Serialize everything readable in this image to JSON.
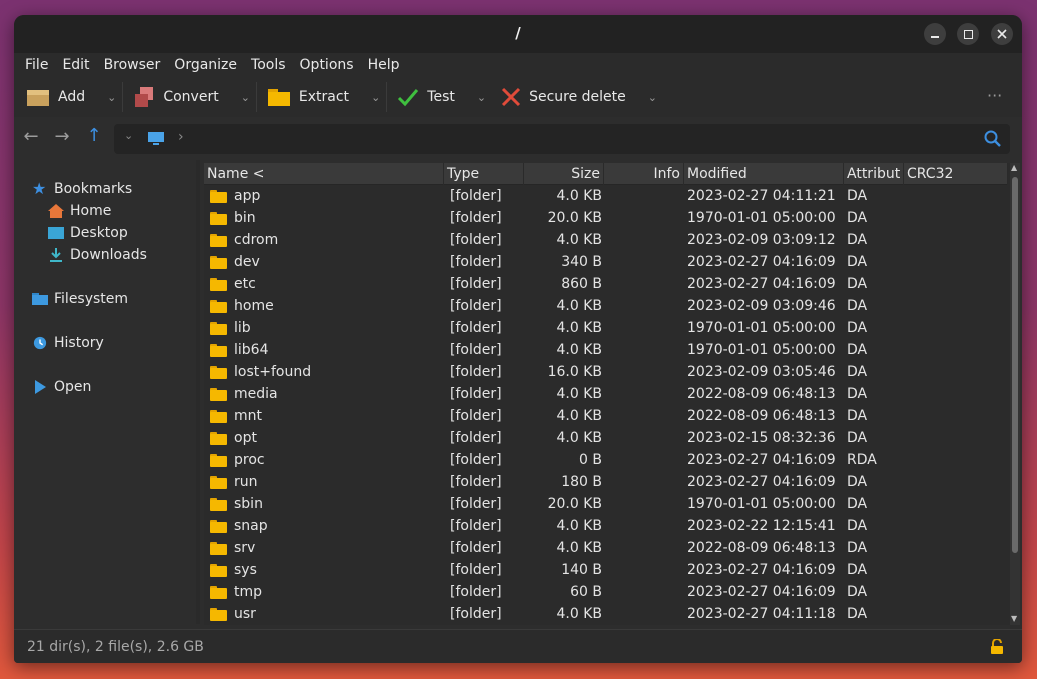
{
  "window": {
    "title": "/"
  },
  "menu": [
    "File",
    "Edit",
    "Browser",
    "Organize",
    "Tools",
    "Options",
    "Help"
  ],
  "toolbar": {
    "add_label": "Add",
    "convert_label": "Convert",
    "extract_label": "Extract",
    "test_label": "Test",
    "secure_delete_label": "Secure delete",
    "more": "···"
  },
  "sidebar": {
    "bookmarks": "Bookmarks",
    "home": "Home",
    "desktop": "Desktop",
    "downloads": "Downloads",
    "filesystem": "Filesystem",
    "history": "History",
    "open": "Open"
  },
  "columns": [
    "Name <",
    "Type",
    "Size",
    "Info",
    "Modified",
    "Attribut",
    "CRC32"
  ],
  "rows": [
    {
      "name": "app",
      "type": "[folder]",
      "size": "4.0 KB",
      "modified": "2023-02-27 04:11:21",
      "attr": "DA"
    },
    {
      "name": "bin",
      "type": "[folder]",
      "size": "20.0 KB",
      "modified": "1970-01-01 05:00:00",
      "attr": "DA"
    },
    {
      "name": "cdrom",
      "type": "[folder]",
      "size": "4.0 KB",
      "modified": "2023-02-09 03:09:12",
      "attr": "DA"
    },
    {
      "name": "dev",
      "type": "[folder]",
      "size": "340 B",
      "modified": "2023-02-27 04:16:09",
      "attr": "DA"
    },
    {
      "name": "etc",
      "type": "[folder]",
      "size": "860 B",
      "modified": "2023-02-27 04:16:09",
      "attr": "DA"
    },
    {
      "name": "home",
      "type": "[folder]",
      "size": "4.0 KB",
      "modified": "2023-02-09 03:09:46",
      "attr": "DA"
    },
    {
      "name": "lib",
      "type": "[folder]",
      "size": "4.0 KB",
      "modified": "1970-01-01 05:00:00",
      "attr": "DA"
    },
    {
      "name": "lib64",
      "type": "[folder]",
      "size": "4.0 KB",
      "modified": "1970-01-01 05:00:00",
      "attr": "DA"
    },
    {
      "name": "lost+found",
      "type": "[folder]",
      "size": "16.0 KB",
      "modified": "2023-02-09 03:05:46",
      "attr": "DA"
    },
    {
      "name": "media",
      "type": "[folder]",
      "size": "4.0 KB",
      "modified": "2022-08-09 06:48:13",
      "attr": "DA"
    },
    {
      "name": "mnt",
      "type": "[folder]",
      "size": "4.0 KB",
      "modified": "2022-08-09 06:48:13",
      "attr": "DA"
    },
    {
      "name": "opt",
      "type": "[folder]",
      "size": "4.0 KB",
      "modified": "2023-02-15 08:32:36",
      "attr": "DA"
    },
    {
      "name": "proc",
      "type": "[folder]",
      "size": "0 B",
      "modified": "2023-02-27 04:16:09",
      "attr": "RDA"
    },
    {
      "name": "run",
      "type": "[folder]",
      "size": "180 B",
      "modified": "2023-02-27 04:16:09",
      "attr": "DA"
    },
    {
      "name": "sbin",
      "type": "[folder]",
      "size": "20.0 KB",
      "modified": "1970-01-01 05:00:00",
      "attr": "DA"
    },
    {
      "name": "snap",
      "type": "[folder]",
      "size": "4.0 KB",
      "modified": "2023-02-22 12:15:41",
      "attr": "DA"
    },
    {
      "name": "srv",
      "type": "[folder]",
      "size": "4.0 KB",
      "modified": "2022-08-09 06:48:13",
      "attr": "DA"
    },
    {
      "name": "sys",
      "type": "[folder]",
      "size": "140 B",
      "modified": "2023-02-27 04:16:09",
      "attr": "DA"
    },
    {
      "name": "tmp",
      "type": "[folder]",
      "size": "60 B",
      "modified": "2023-02-27 04:16:09",
      "attr": "DA"
    },
    {
      "name": "usr",
      "type": "[folder]",
      "size": "4.0 KB",
      "modified": "2023-02-27 04:11:18",
      "attr": "DA"
    }
  ],
  "status": {
    "summary": "21 dir(s), 2 file(s), 2.6 GB"
  },
  "colors": {
    "accent": "#3d8fe0",
    "folder": "#f5b800",
    "background": "#2d2d2d"
  },
  "icons": {
    "add": "add-archive-icon",
    "convert": "convert-icon",
    "extract": "extract-folder-icon",
    "test": "checkmark-icon",
    "secure_delete": "red-x-icon",
    "search": "search-icon",
    "lock": "unlock-icon"
  }
}
